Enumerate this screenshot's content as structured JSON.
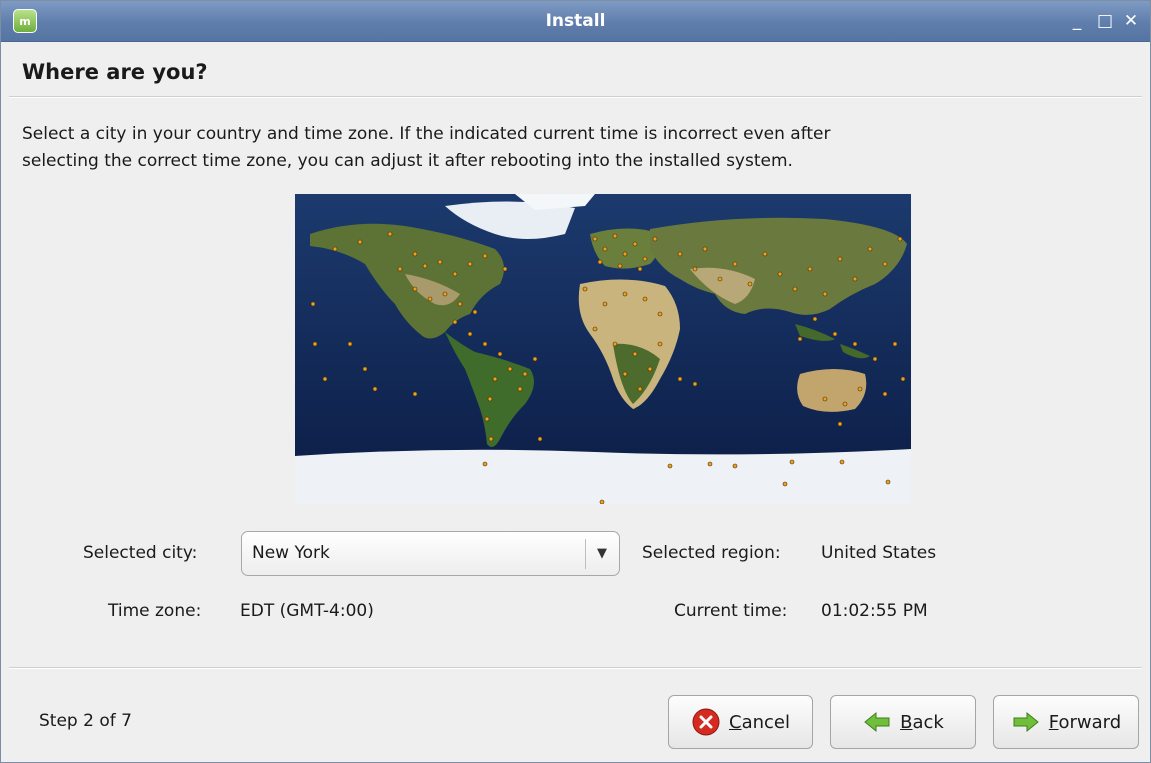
{
  "window": {
    "title": "Install",
    "icon": "linux-mint-logo-icon",
    "controls": [
      "minimize-icon",
      "maximize-icon",
      "close-icon"
    ]
  },
  "page": {
    "heading": "Where are you?",
    "description_line1": "Select a city in your country and time zone. If the indicated current time is incorrect even after",
    "description_line2": "selecting the correct time zone, you can adjust it after rebooting into the installed system."
  },
  "map": {
    "type": "world-timezone-map",
    "marker_color": "#f0a020"
  },
  "fields": {
    "selected_city_label": "Selected city:",
    "selected_city_value": "New York",
    "selected_region_label": "Selected region:",
    "selected_region_value": "United States",
    "time_zone_label": "Time zone:",
    "time_zone_value": "EDT (GMT-4:00)",
    "current_time_label": "Current time:",
    "current_time_value": "01:02:55 PM"
  },
  "footer": {
    "step_text": "Step 2 of 7",
    "cancel_mnemonic": "C",
    "cancel_rest": "ancel",
    "back_mnemonic": "B",
    "back_rest": "ack",
    "forward_mnemonic": "F",
    "forward_rest": "orward"
  },
  "colors": {
    "titlebar": "#6886b4",
    "cancel_icon": "#d42a1f",
    "arrow_icon": "#6fbf3a"
  }
}
